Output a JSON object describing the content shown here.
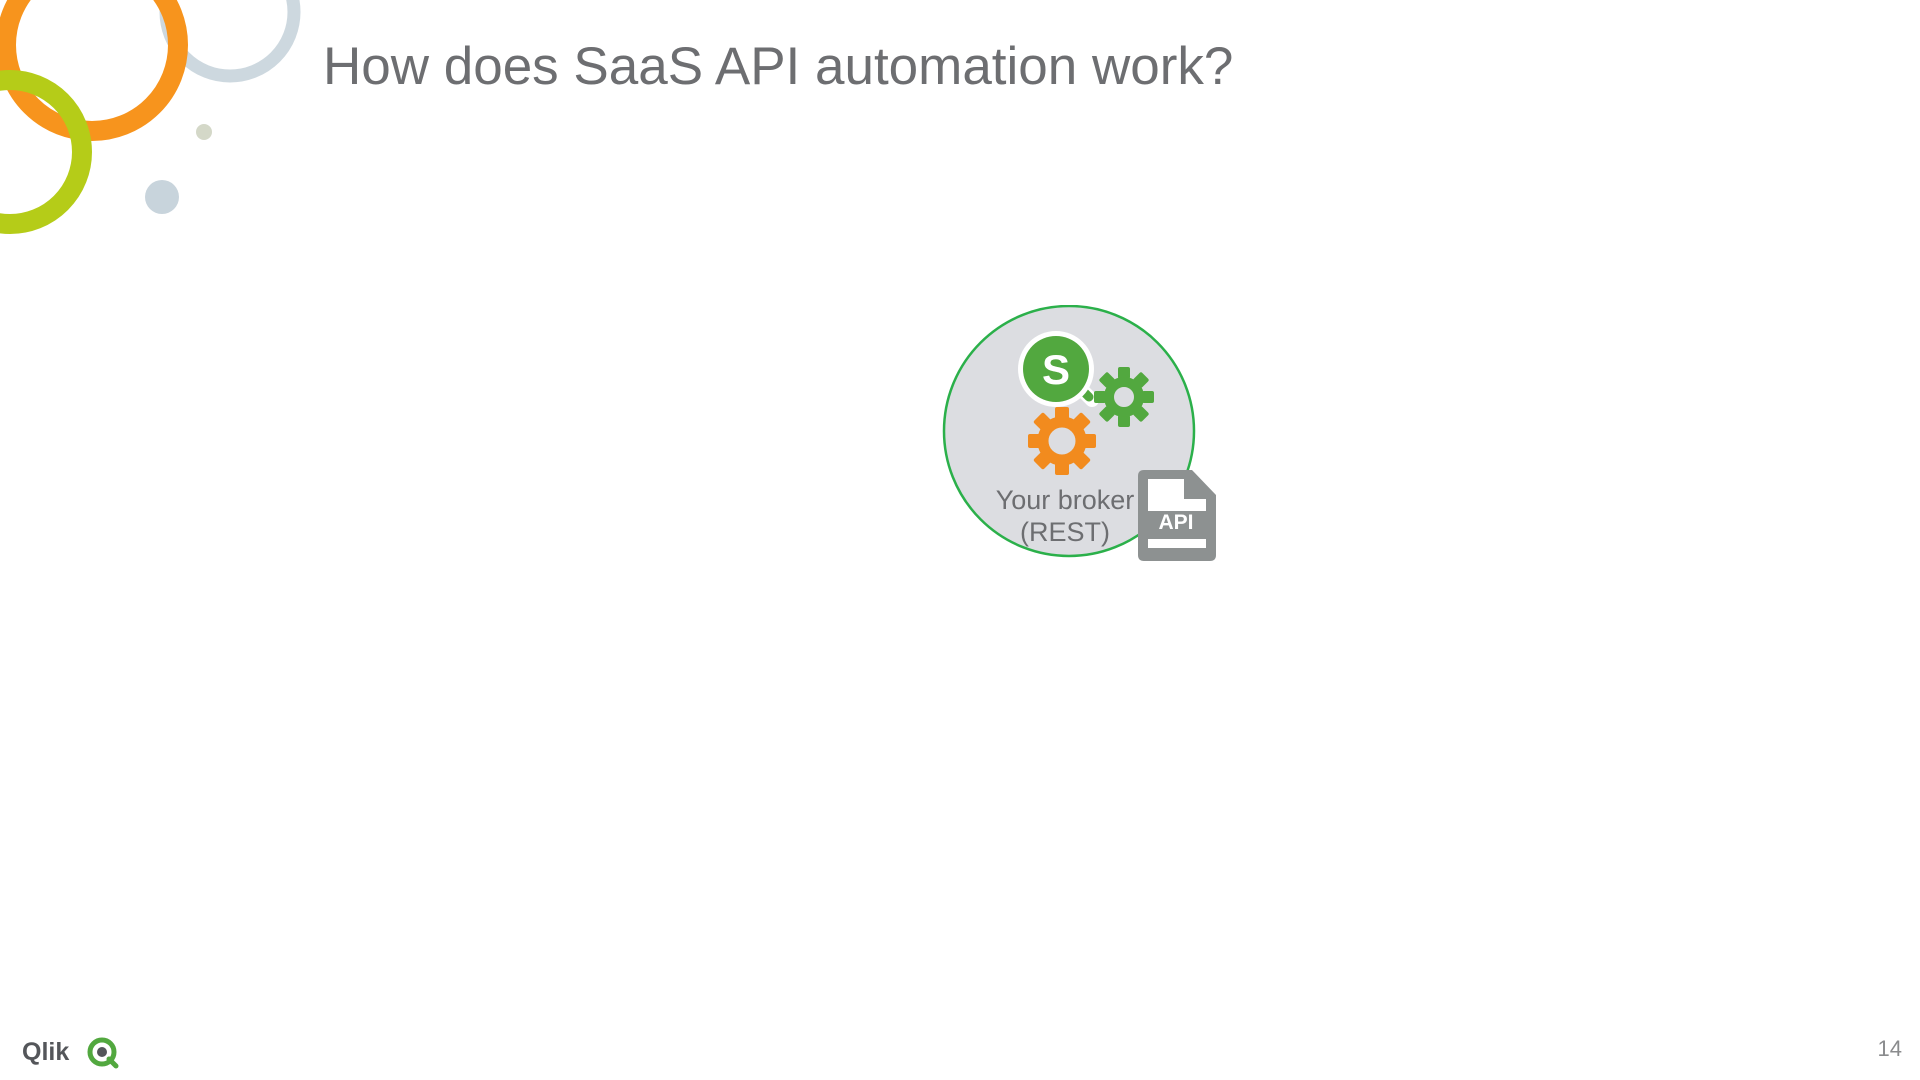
{
  "slide": {
    "title": "How does SaaS API automation work?",
    "page_number": "14"
  },
  "broker": {
    "label_line1": "Your broker",
    "label_line2": "(REST)",
    "s_badge_letter": "S",
    "doc_badge_text": "API"
  },
  "logo": {
    "text": "Qlik",
    "icon": "qlik-q-icon"
  },
  "colors": {
    "title_text": "#6d6e71",
    "broker_circle_fill": "#dcdde1",
    "broker_circle_stroke": "#2bb04a",
    "qlik_green": "#52a83f",
    "gear_green": "#52a83f",
    "gear_orange": "#f28b1e",
    "api_doc_gray": "#8d9191",
    "decor_orange": "#f7941d",
    "decor_lime": "#b5cc18",
    "decor_blue_gray": "#c8d4dc"
  },
  "icons": [
    "qlik-s-badge-icon",
    "green-gear-icon",
    "orange-gear-icon",
    "api-document-icon",
    "qlik-q-icon"
  ]
}
